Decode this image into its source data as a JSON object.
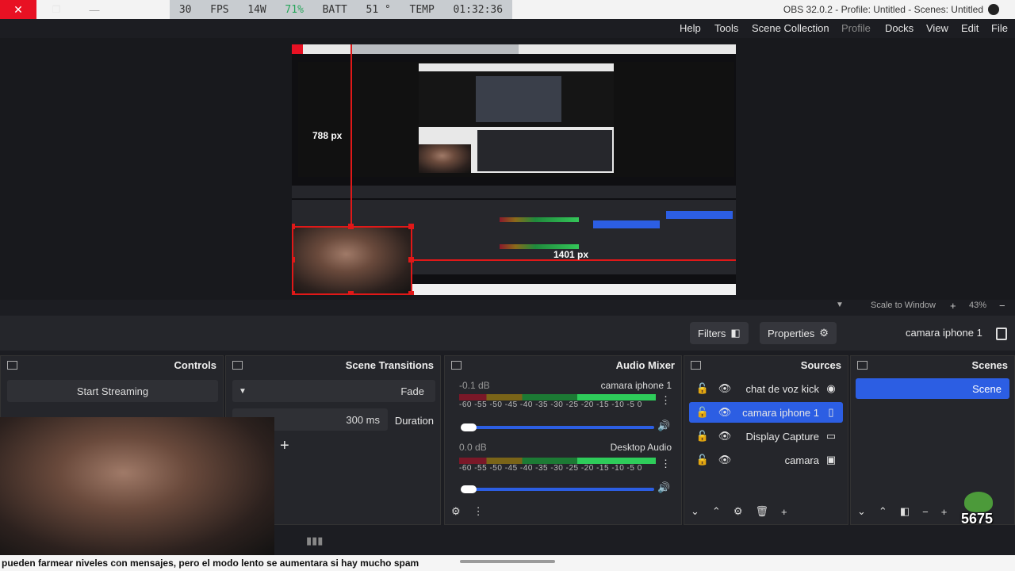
{
  "window": {
    "title": "OBS 32.0.2 - Profile: Untitled - Scenes: Untitled"
  },
  "status_overlay": {
    "items": [
      "01:32:36",
      "TEMP",
      "51 °",
      "BATT",
      "71%",
      "14W",
      "FPS",
      "30"
    ]
  },
  "menu": [
    "File",
    "Edit",
    "View",
    "Docks",
    "Profile",
    "Scene Collection",
    "Tools",
    "Help"
  ],
  "preview": {
    "measure_vertical": "788 px",
    "measure_horizontal": "1401 px",
    "scale_label": "Scale to Window",
    "zoom": "43%"
  },
  "context_bar": {
    "source_name": "camara iphone 1",
    "properties_label": "Properties",
    "filters_label": "Filters"
  },
  "scenes": {
    "title": "Scenes",
    "items": [
      "Scene"
    ]
  },
  "sources": {
    "title": "Sources",
    "items": [
      "chat de voz kick",
      "camara iphone 1",
      "Display Capture",
      "camara"
    ]
  },
  "audio_mixer": {
    "title": "Audio Mixer",
    "channels": [
      {
        "name": "camara iphone 1",
        "db": "-0.1 dB"
      },
      {
        "name": "Desktop Audio",
        "db": "0.0 dB"
      }
    ],
    "scale": "-60 -55 -50 -45 -40 -35 -30 -25 -20 -15 -10 -5 0"
  },
  "scene_transitions": {
    "title": "Scene Transitions",
    "transition": "Fade",
    "duration_label": "Duration",
    "duration_value": "300 ms"
  },
  "controls": {
    "title": "Controls",
    "start_streaming": "Start Streaming"
  },
  "overlay": {
    "subtitle": "pueden farmear niveles con mensajes, pero el modo lento se aumentara si hay mucho spam",
    "viewer_count": "5675"
  },
  "colors": {
    "accent": "#2c5ee3",
    "guide_red": "#e01818",
    "close_red": "#e81123"
  }
}
